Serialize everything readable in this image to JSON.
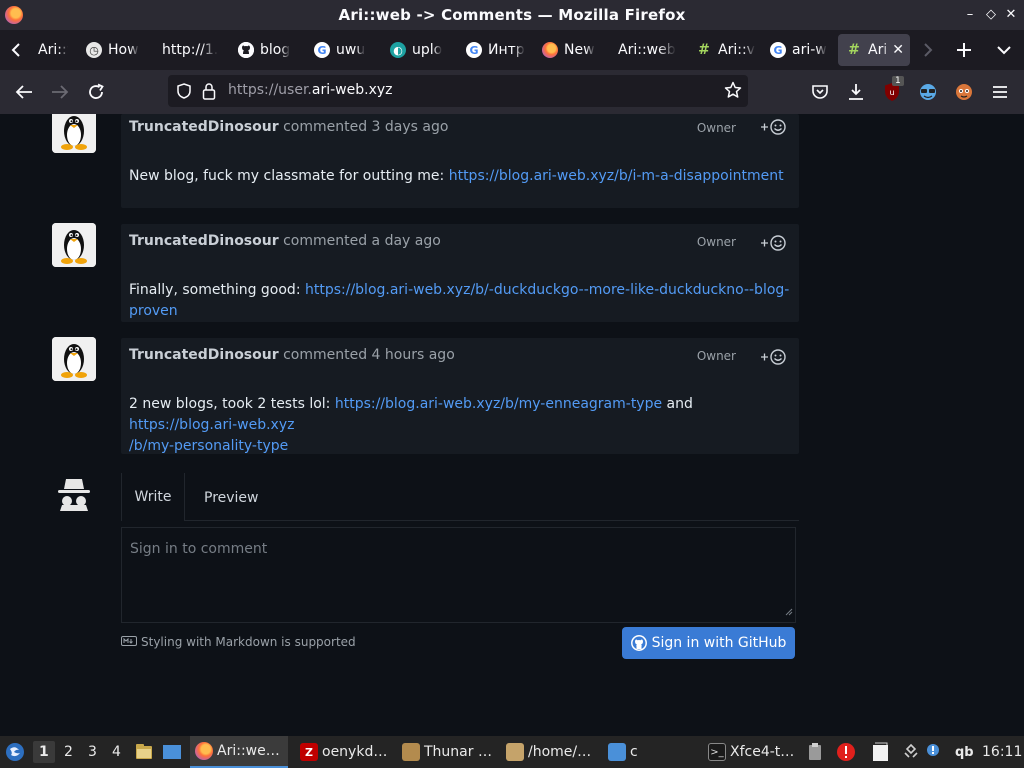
{
  "window": {
    "title": "Ari::web -> Comments — Mozilla Firefox",
    "minimize_label": "–",
    "maximize_label": "◇",
    "close_label": "✕"
  },
  "tabs": [
    {
      "label": "Ari::v",
      "icon": "hashtag-icon"
    },
    {
      "label": "How",
      "icon": "clock-icon"
    },
    {
      "label": "http://1.",
      "icon": "none"
    },
    {
      "label": "blog",
      "icon": "github-icon"
    },
    {
      "label": "uwu",
      "icon": "google-icon"
    },
    {
      "label": "uplo",
      "icon": "upload-icon"
    },
    {
      "label": "Интр",
      "icon": "google-icon"
    },
    {
      "label": "New",
      "icon": "firefox-icon"
    },
    {
      "label": "Ari::web",
      "icon": "none"
    },
    {
      "label": "Ari::v",
      "icon": "hashtag-icon"
    },
    {
      "label": "ari-w",
      "icon": "google-icon"
    },
    {
      "label": "Ari",
      "icon": "hashtag-icon"
    }
  ],
  "navbar": {
    "url_prefix": "https://user.",
    "url_domain": "ari-web.xyz",
    "ublock_badge": "1"
  },
  "comments": [
    {
      "author": "TruncatedDinosour",
      "when": "commented 3 days ago",
      "role": "Owner",
      "text": "New blog, fuck my classmate for outting me: ",
      "link": "https://blog.ari-web.xyz/b/i-m-a-disappointment"
    },
    {
      "author": "TruncatedDinosour",
      "when": "commented a day ago",
      "role": "Owner",
      "text": "Finally, something good: ",
      "link": "https://blog.ari-web.xyz/b/-duckduckgo--more-like-duckduckno--blog-proven"
    },
    {
      "author": "TruncatedDinosour",
      "when": "commented 4 hours ago",
      "role": "Owner",
      "text": "2 new blogs, took 2 tests lol: ",
      "link": "https://blog.ari-web.xyz/b/my-enneagram-type",
      "mid": " and ",
      "link2_line1": "https://blog.ari-web.xyz",
      "link2_line2": "/b/my-personality-type"
    }
  ],
  "editor": {
    "tab_write": "Write",
    "tab_preview": "Preview",
    "placeholder": "Sign in to comment",
    "markdown_note": "Styling with Markdown is supported",
    "signin_button": "Sign in with GitHub"
  },
  "taskbar": {
    "workspaces": [
      "1",
      "2",
      "3",
      "4"
    ],
    "tasks": [
      {
        "label": "Ari::we…",
        "icon": "firefox-icon"
      },
      {
        "label": "oenykd…",
        "icon": "filezilla-icon"
      },
      {
        "label": "Thunar …",
        "icon": "folder-icon"
      },
      {
        "label": "/home/…",
        "icon": "archive-icon"
      },
      {
        "label": "c",
        "icon": "folder-icon"
      },
      {
        "label": "Xfce4-t…",
        "icon": "terminal-icon"
      }
    ],
    "tray_qb": "qb",
    "clock": "16:11"
  }
}
